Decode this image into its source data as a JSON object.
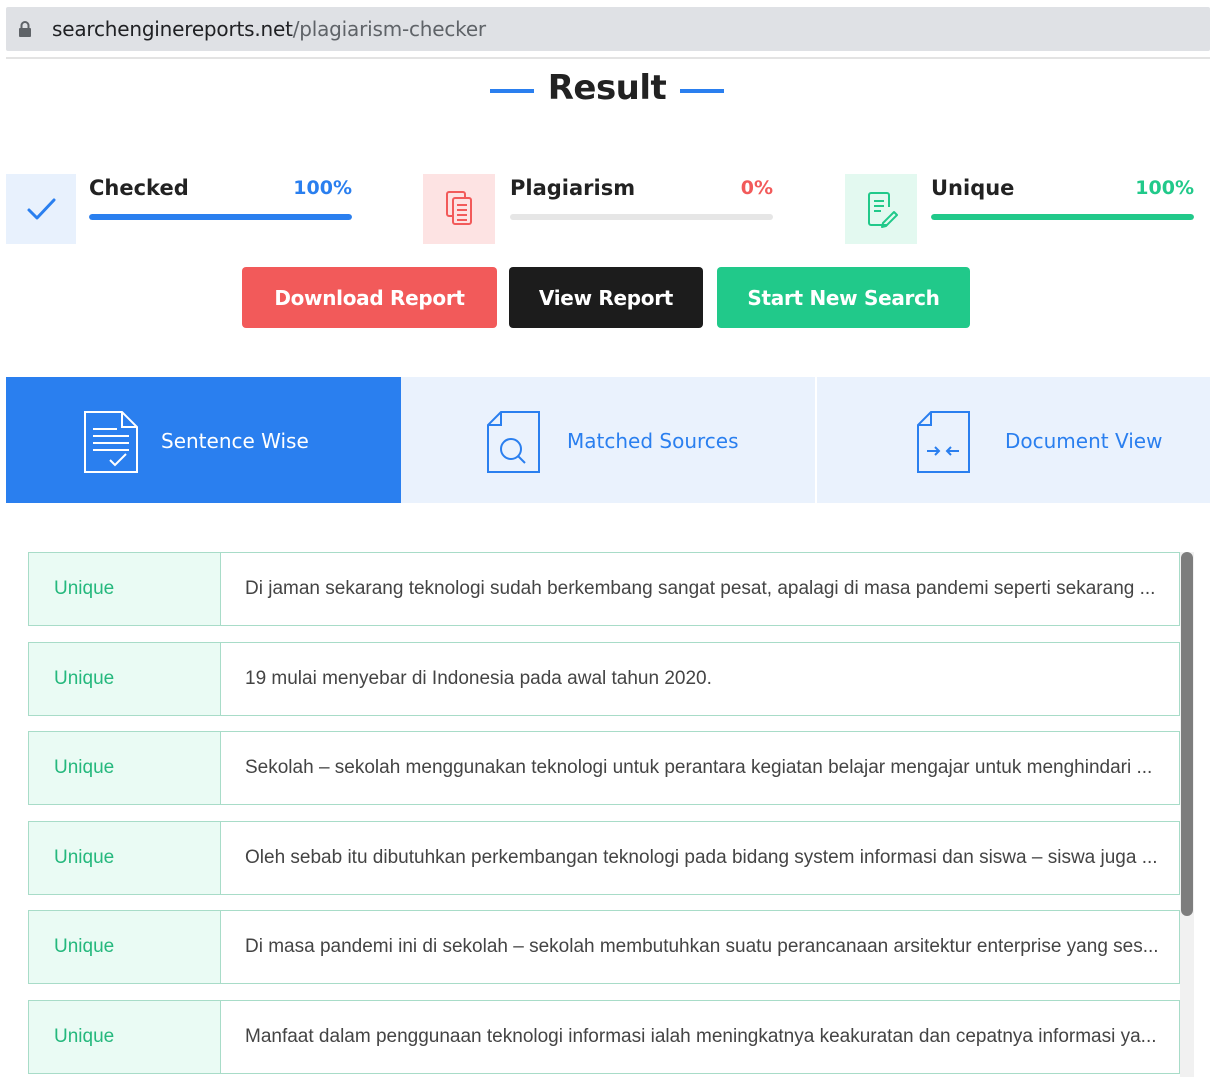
{
  "browser": {
    "url_host": "searchenginereports.net",
    "url_path": "/plagiarism-checker"
  },
  "result": {
    "title": "Result"
  },
  "stats": [
    {
      "label": "Checked",
      "percent": "100%",
      "fraction": 1.0,
      "color": "#2a7fef",
      "icon_bg": "#e8f1fd",
      "icon": "check-icon"
    },
    {
      "label": "Plagiarism",
      "percent": "0%",
      "fraction": 0.0,
      "color": "#f25a5a",
      "icon_bg": "#fde3e3",
      "icon": "documents-icon"
    },
    {
      "label": "Unique",
      "percent": "100%",
      "fraction": 1.0,
      "color": "#21c98a",
      "icon_bg": "#e3f9f0",
      "icon": "edit-document-icon"
    }
  ],
  "buttons": {
    "download": "Download Report",
    "view": "View Report",
    "new_search": "Start New Search"
  },
  "colors": {
    "download": "#f25a5a",
    "view": "#1c1c1c",
    "new_search": "#21c98a",
    "tab_active_bg": "#2a7fef",
    "tab_inactive_bg": "#eaf2fd",
    "tab_inactive_text": "#2a7fef"
  },
  "tabs": [
    {
      "label": "Sentence Wise",
      "active": true,
      "icon": "sentence-document-icon"
    },
    {
      "label": "Matched Sources",
      "active": false,
      "icon": "search-document-icon"
    },
    {
      "label": "Document View",
      "active": false,
      "icon": "compare-document-icon"
    }
  ],
  "sentences": [
    {
      "status": "Unique",
      "text": "Di jaman sekarang teknologi sudah berkembang sangat pesat, apalagi di masa pandemi seperti sekarang ..."
    },
    {
      "status": "Unique",
      "text": "19 mulai menyebar di Indonesia pada awal tahun 2020."
    },
    {
      "status": "Unique",
      "text": "Sekolah – sekolah menggunakan teknologi untuk perantara kegiatan belajar mengajar untuk menghindari ..."
    },
    {
      "status": "Unique",
      "text": "Oleh sebab itu dibutuhkan perkembangan teknologi pada bidang system informasi dan siswa – siswa juga ..."
    },
    {
      "status": "Unique",
      "text": "Di masa pandemi ini di sekolah – sekolah membutuhkan suatu perancanaan arsitektur enterprise yang ses..."
    },
    {
      "status": "Unique",
      "text": "Manfaat dalam penggunaan teknologi informasi ialah meningkatnya keakuratan dan cepatnya informasi ya..."
    }
  ]
}
